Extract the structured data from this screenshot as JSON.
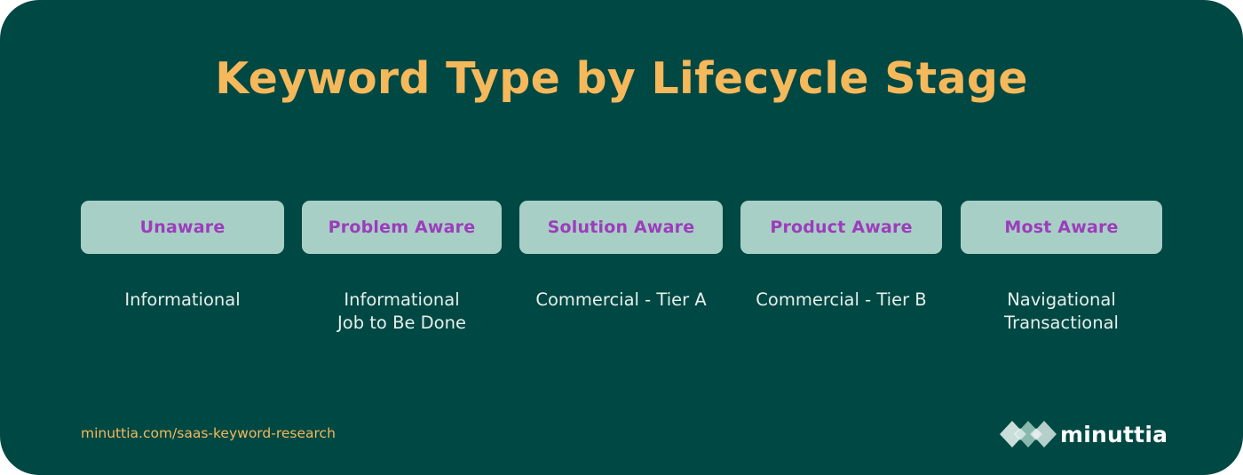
{
  "title": "Keyword Type by Lifecycle Stage",
  "stages": [
    {
      "label": "Unaware",
      "keywords": [
        "Informational"
      ]
    },
    {
      "label": "Problem Aware",
      "keywords": [
        "Informational",
        "Job to Be Done"
      ]
    },
    {
      "label": "Solution Aware",
      "keywords": [
        "Commercial - Tier A"
      ]
    },
    {
      "label": "Product Aware",
      "keywords": [
        "Commercial - Tier B"
      ]
    },
    {
      "label": "Most Aware",
      "keywords": [
        "Navigational",
        "Transactional"
      ]
    }
  ],
  "footer": {
    "url": "minuttia.com/saas-keyword-research",
    "brand": "minuttia",
    "logo_icon": "diamond-mark-icon"
  },
  "colors": {
    "background": "#004843",
    "title": "#f5b85a",
    "stage_box": "#a8cfc6",
    "stage_text": "#9c3dbb",
    "keyword_text": "#e6efec"
  }
}
